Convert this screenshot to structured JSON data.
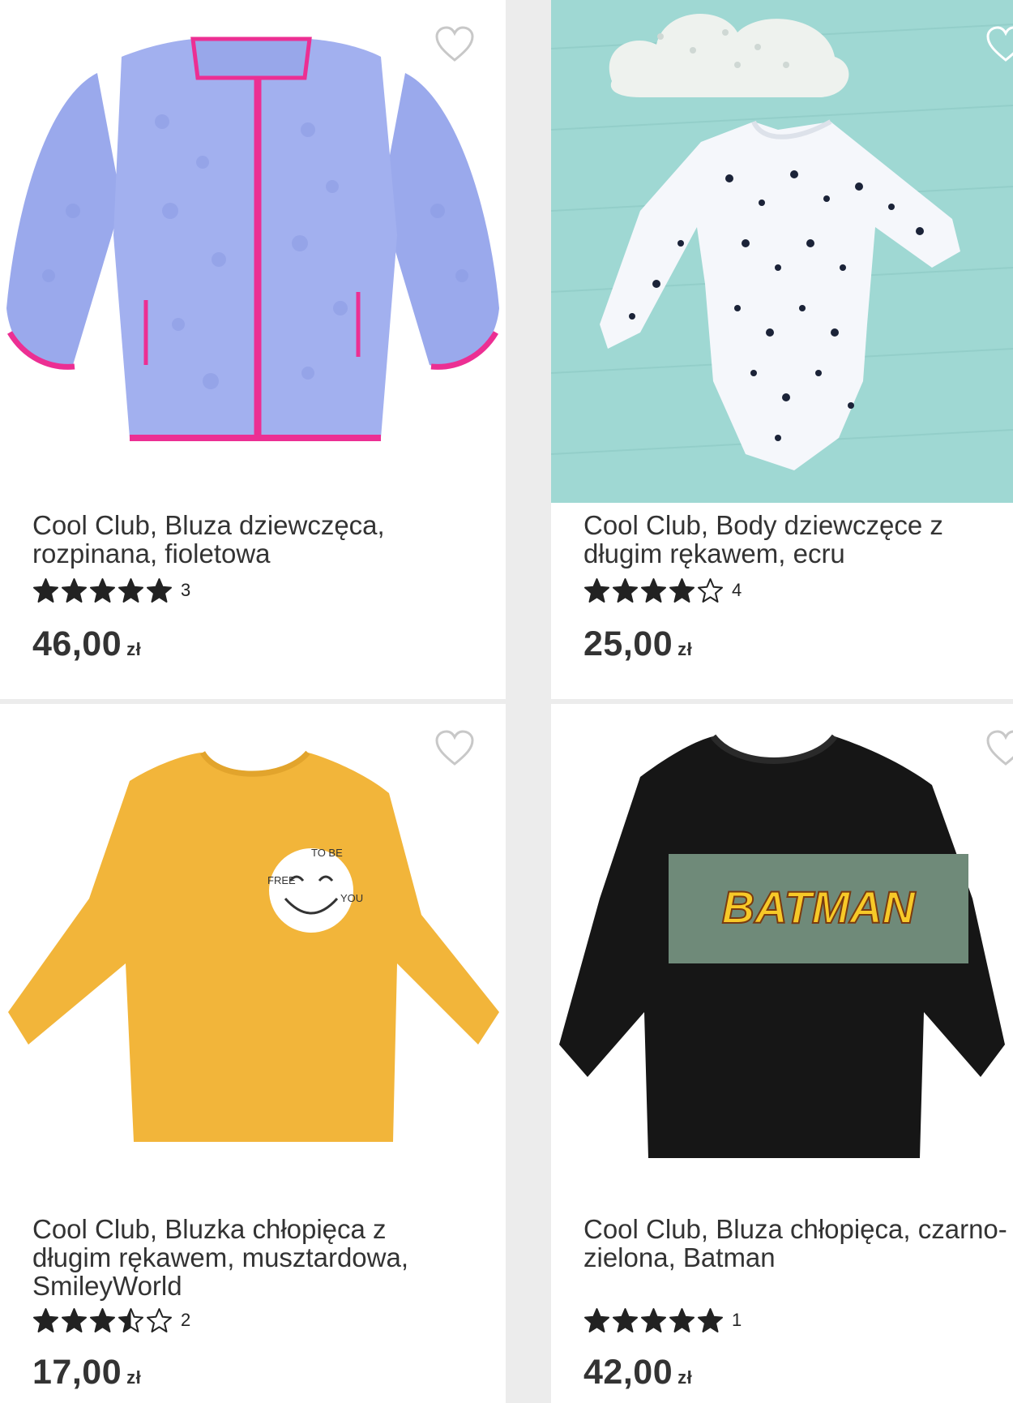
{
  "products": [
    {
      "name": "Cool Club, Bluza dziewczęca, rozpinana, fioletowa",
      "rating": 5,
      "review_count": "3",
      "price": "46,00",
      "currency": "zł",
      "image_icon": "purple-fleece-jacket-image"
    },
    {
      "name": "Cool Club, Body dziewczęce z długim rękawem, ecru",
      "rating": 4,
      "review_count": "4",
      "price": "25,00",
      "currency": "zł",
      "image_icon": "patterned-bodysuit-image"
    },
    {
      "name": "Cool Club, Bluzka chłopięca z długim rękawem, musztardowa, SmileyWorld",
      "rating": 3.5,
      "review_count": "2",
      "price": "17,00",
      "currency": "zł",
      "image_icon": "mustard-smiley-shirt-image",
      "print_text": [
        "FREE",
        "TO BE",
        "YOU"
      ]
    },
    {
      "name": "Cool Club, Bluza chłopięca, czarno-zielona, Batman",
      "rating": 5,
      "review_count": "1",
      "price": "42,00",
      "currency": "zł",
      "image_icon": "batman-sweatshirt-image",
      "print_text": [
        "BATMAN"
      ]
    }
  ],
  "colors": {
    "star": "#222222",
    "heart_outline": "#c8c8c8",
    "fleece": "#9aa9ec",
    "fleece_trim": "#ec2f93",
    "mint": "#9fd8d3",
    "mustard": "#f2b53a",
    "sweat_black": "#161616",
    "sweat_green": "#6f8a79",
    "batman_yellow": "#f7c928"
  },
  "icons": {
    "favorite": "heart-outline-icon",
    "star_full": "star-filled-icon",
    "star_half": "star-half-icon",
    "star_empty": "star-outline-icon"
  }
}
